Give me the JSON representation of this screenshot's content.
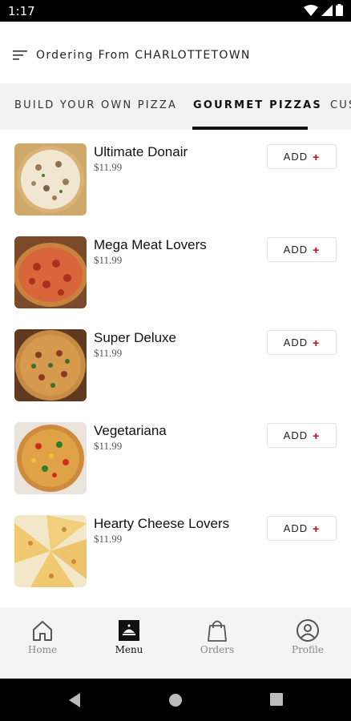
{
  "status_bar": {
    "time": "1:17"
  },
  "header": {
    "title": "Ordering From CHARLOTTETOWN"
  },
  "tabs": [
    {
      "label": "BUILD YOUR OWN PIZZA"
    },
    {
      "label": "GOURMET PIZZAS"
    },
    {
      "label": "CUS"
    }
  ],
  "items": [
    {
      "name": "Ultimate Donair",
      "price": "$11.99",
      "add_label": "ADD"
    },
    {
      "name": "Mega Meat Lovers",
      "price": "$11.99",
      "add_label": "ADD"
    },
    {
      "name": "Super Deluxe",
      "price": "$11.99",
      "add_label": "ADD"
    },
    {
      "name": "Vegetariana",
      "price": "$11.99",
      "add_label": "ADD"
    },
    {
      "name": "Hearty Cheese Lovers",
      "price": "$11.99",
      "add_label": "ADD"
    }
  ],
  "add_icon": "+",
  "bottom_nav": [
    {
      "label": "Home",
      "icon": "home-icon"
    },
    {
      "label": "Menu",
      "icon": "menu-icon"
    },
    {
      "label": "Orders",
      "icon": "bag-icon"
    },
    {
      "label": "Profile",
      "icon": "profile-icon"
    }
  ],
  "colors": {
    "accent": "#d0021b",
    "tab_bg": "#f2f2f2",
    "nav_bg": "#f4f4f4"
  }
}
